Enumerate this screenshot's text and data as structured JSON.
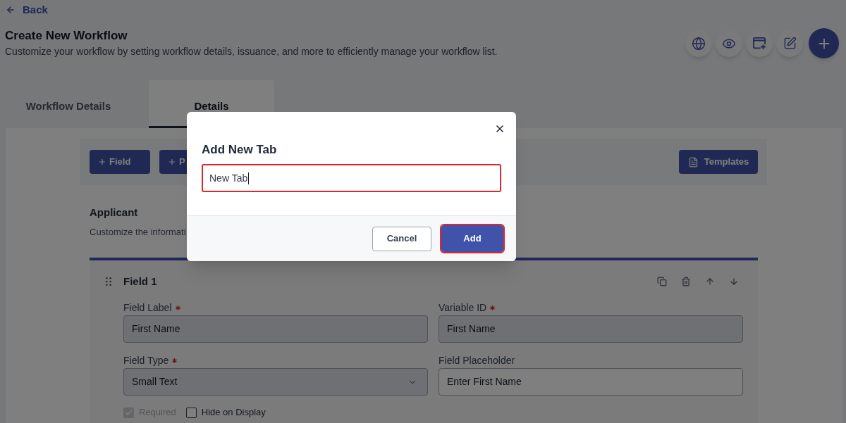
{
  "back_link": {
    "label": "Back"
  },
  "header": {
    "title": "Create New Workflow",
    "subtitle": "Customize your workflow by setting workflow details, issuance, and more to efficiently manage your workflow list."
  },
  "tabs": [
    {
      "label": "Workflow Details",
      "selected": false
    },
    {
      "label": "Details",
      "selected": true
    }
  ],
  "builder": {
    "buttons": [
      {
        "label": "Field"
      },
      {
        "label": "P"
      }
    ],
    "templates_button": {
      "label": "Templates"
    }
  },
  "section": {
    "title": "Applicant",
    "description": "Customize the informati"
  },
  "field_card": {
    "title": "Field 1",
    "inputs": [
      {
        "label": "Field Label",
        "required": true,
        "kind": "text",
        "value": "First Name",
        "disabled": true
      },
      {
        "label": "Variable ID",
        "required": true,
        "kind": "text",
        "value": "First Name",
        "disabled": true
      },
      {
        "label": "Field Type",
        "required": true,
        "kind": "select",
        "value": "Small Text",
        "disabled": true
      },
      {
        "label": "Field Placeholder",
        "required": false,
        "kind": "text",
        "value": "Enter First Name",
        "disabled": false
      }
    ],
    "options": [
      {
        "label": "Required",
        "checked": true,
        "disabled": true
      },
      {
        "label": "Hide on Display",
        "checked": false,
        "disabled": false
      }
    ]
  },
  "modal": {
    "title": "Add New Tab",
    "input": {
      "value": "New Tab",
      "focused": true,
      "highlighted": true
    },
    "buttons": [
      {
        "label": "Cancel",
        "kind": "secondary",
        "highlighted": false
      },
      {
        "label": "Add",
        "kind": "primary",
        "highlighted": true
      }
    ]
  }
}
